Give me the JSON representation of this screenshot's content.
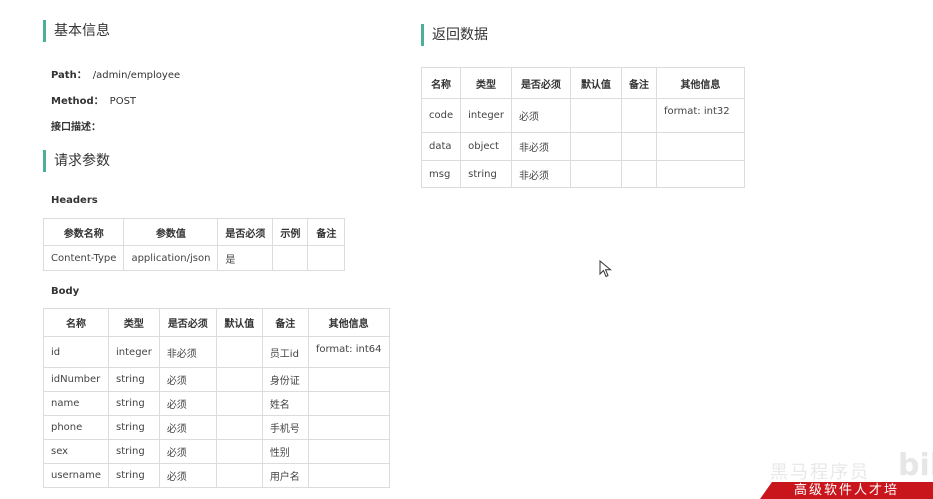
{
  "basic": {
    "title": "基本信息",
    "path_label": "Path：",
    "path_value": "/admin/employee",
    "method_label": "Method：",
    "method_value": "POST",
    "desc_label": "接口描述："
  },
  "request": {
    "title": "请求参数",
    "headers_label": "Headers",
    "headers_columns": [
      "参数名称",
      "参数值",
      "是否必须",
      "示例",
      "备注"
    ],
    "headers_rows": [
      [
        "Content-Type",
        "application/json",
        "是",
        "",
        ""
      ]
    ],
    "body_label": "Body",
    "body_columns": [
      "名称",
      "类型",
      "是否必须",
      "默认值",
      "备注",
      "其他信息"
    ],
    "body_rows": [
      [
        "id",
        "integer",
        "非必须",
        "",
        "员工id",
        "format: int64"
      ],
      [
        "idNumber",
        "string",
        "必须",
        "",
        "身份证",
        ""
      ],
      [
        "name",
        "string",
        "必须",
        "",
        "姓名",
        ""
      ],
      [
        "phone",
        "string",
        "必须",
        "",
        "手机号",
        ""
      ],
      [
        "sex",
        "string",
        "必须",
        "",
        "性别",
        ""
      ],
      [
        "username",
        "string",
        "必须",
        "",
        "用户名",
        ""
      ]
    ]
  },
  "response": {
    "title": "返回数据",
    "columns": [
      "名称",
      "类型",
      "是否必须",
      "默认值",
      "备注",
      "其他信息"
    ],
    "rows": [
      [
        "code",
        "integer",
        "必须",
        "",
        "",
        "format: int32"
      ],
      [
        "data",
        "object",
        "非必须",
        "",
        "",
        ""
      ],
      [
        "msg",
        "string",
        "非必须",
        "",
        "",
        ""
      ]
    ]
  },
  "watermark": {
    "text": "黑马程序员",
    "banner": "高级软件人才培",
    "logo": "bili"
  }
}
